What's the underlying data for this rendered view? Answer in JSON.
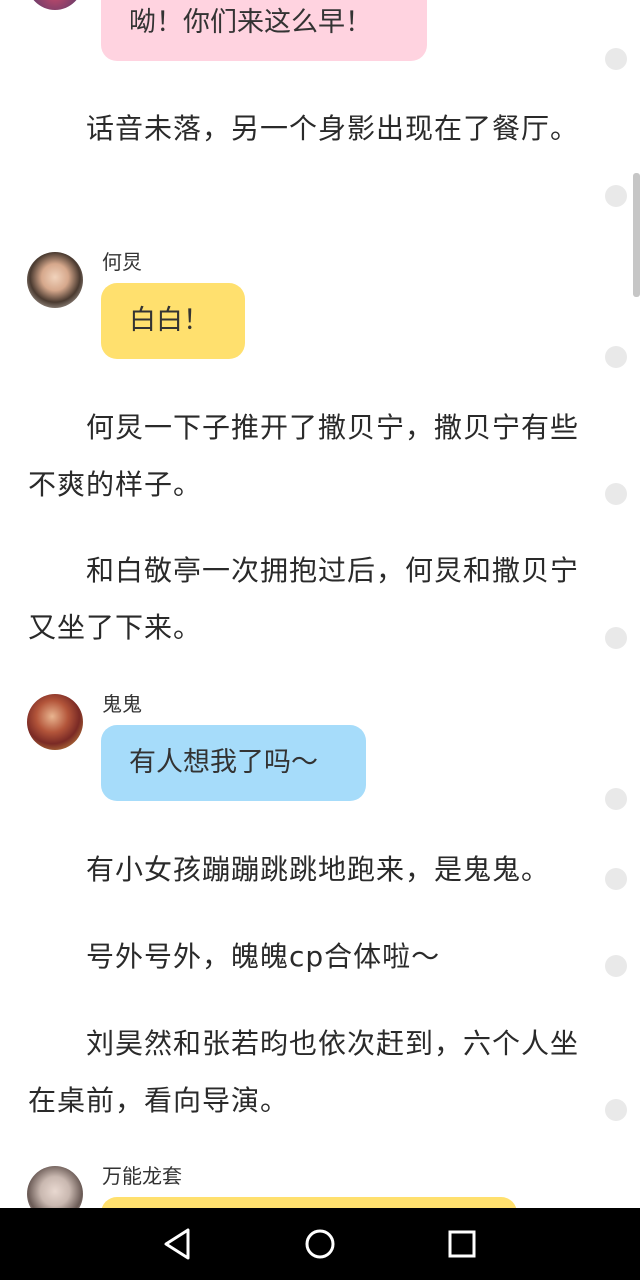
{
  "story": {
    "bubble_top": {
      "text": "呦！你们来这么早！",
      "color": "#ffd3e0"
    },
    "p1": "话音未落，另一个身影出现在了餐厅。",
    "msg1": {
      "speaker": "何炅",
      "text": "白白！",
      "color": "#ffe06e"
    },
    "p2": "何炅一下子推开了撒贝宁，撒贝宁有些不爽的样子。",
    "p3": "和白敬亭一次拥抱过后，何炅和撒贝宁又坐了下来。",
    "msg2": {
      "speaker": "鬼鬼",
      "text": "有人想我了吗～",
      "color": "#a6dcfa"
    },
    "p4": "有小女孩蹦蹦跳跳地跑来，是鬼鬼。",
    "p5": "号外号外，魄魄cp合体啦～",
    "p6": "刘昊然和张若昀也依次赶到，六个人坐在桌前，看向导演。",
    "msg3": {
      "speaker": "万能龙套",
      "color": "#ffe06e"
    }
  },
  "icons": {
    "comment_dot": "comment-dot-icon",
    "back": "back-triangle-icon",
    "home": "home-circle-icon",
    "recents": "recents-square-icon"
  }
}
